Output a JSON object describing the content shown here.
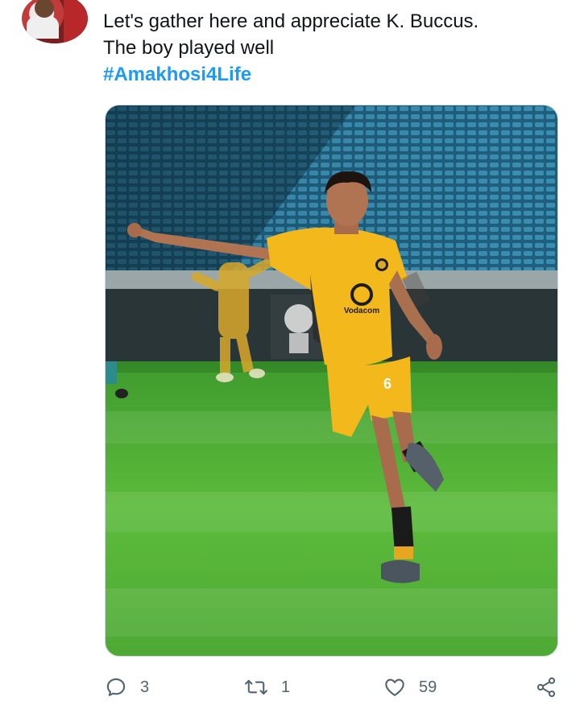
{
  "tweet": {
    "text_line1": "Let's gather here and appreciate K. Buccus.",
    "text_line2": "The boy played well",
    "hashtag": "#Amakhosi4Life"
  },
  "media": {
    "kind": "photo",
    "jersey_number": "6",
    "sponsor": "Vodacom"
  },
  "actions": {
    "reply_count": "3",
    "retweet_count": "1",
    "like_count": "59"
  },
  "colors": {
    "hashtag": "#1d9bf0",
    "icon": "#536471",
    "text": "#0f1419",
    "kit_gold": "#f2b81c",
    "pitch_green": "#57b63a",
    "seats_blue": "#2f7c9e"
  },
  "icons": [
    "reply-icon",
    "retweet-icon",
    "like-icon",
    "share-icon"
  ]
}
